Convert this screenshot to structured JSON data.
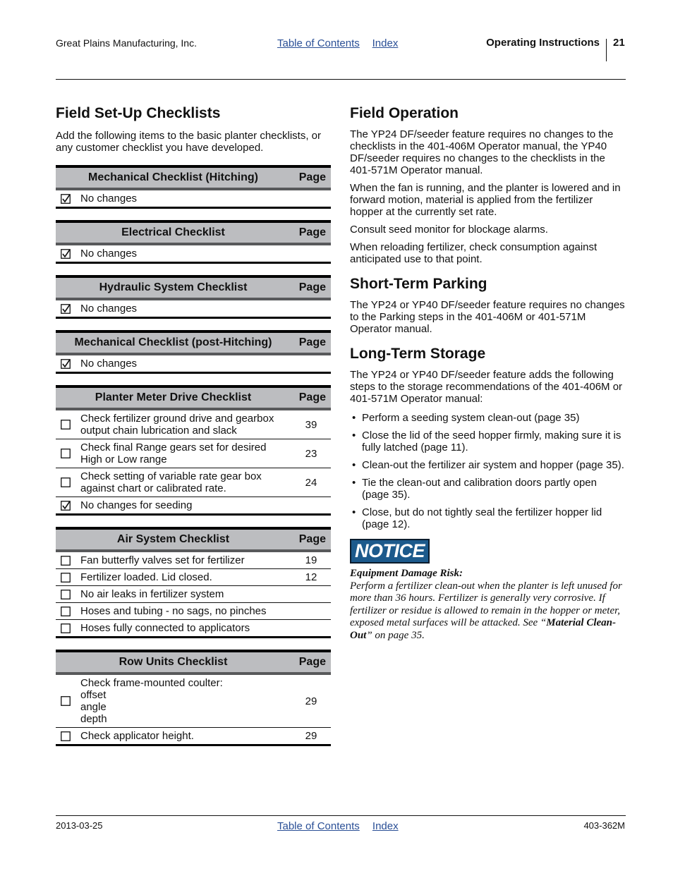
{
  "header": {
    "company": "Great Plains Manufacturing, Inc.",
    "links": [
      "Table of Contents",
      "Index"
    ],
    "section": "Operating Instructions",
    "page_number": "21"
  },
  "left": {
    "title": "Field Set-Up Checklists",
    "intro": "Add the following items to the basic planter checklists, or any customer checklist you have developed.",
    "page_col_label": "Page",
    "checklists": [
      {
        "title": "Mechanical Checklist (Hitching)",
        "rows": [
          {
            "checked": true,
            "lines": [
              "No changes"
            ],
            "page": ""
          }
        ]
      },
      {
        "title": "Electrical Checklist",
        "rows": [
          {
            "checked": true,
            "lines": [
              "No changes"
            ],
            "page": ""
          }
        ]
      },
      {
        "title": "Hydraulic System Checklist",
        "rows": [
          {
            "checked": true,
            "lines": [
              "No changes"
            ],
            "page": ""
          }
        ]
      },
      {
        "title": "Mechanical Checklist (post-Hitching)",
        "rows": [
          {
            "checked": true,
            "lines": [
              "No changes"
            ],
            "page": ""
          }
        ]
      },
      {
        "title": "Planter Meter Drive Checklist",
        "rows": [
          {
            "checked": false,
            "lines": [
              "Check fertilizer ground drive and gearbox",
              "output chain lubrication and slack"
            ],
            "page": "39"
          },
          {
            "checked": false,
            "lines": [
              "Check final Range gears set for desired",
              "High or Low range"
            ],
            "page": "23"
          },
          {
            "checked": false,
            "lines": [
              "Check setting of variable rate gear box",
              "against chart or calibrated rate."
            ],
            "page": "24"
          },
          {
            "checked": true,
            "lines": [
              "No changes for seeding"
            ],
            "page": ""
          }
        ]
      },
      {
        "title": "Air System Checklist",
        "rows": [
          {
            "checked": false,
            "lines": [
              "Fan butterfly valves set for fertilizer"
            ],
            "page": "19"
          },
          {
            "checked": false,
            "lines": [
              "Fertilizer loaded. Lid closed."
            ],
            "page": "12"
          },
          {
            "checked": false,
            "lines": [
              "No air leaks in fertilizer system"
            ],
            "page": ""
          },
          {
            "checked": false,
            "lines": [
              "Hoses and tubing - no sags, no pinches"
            ],
            "page": ""
          },
          {
            "checked": false,
            "lines": [
              "Hoses fully connected to applicators"
            ],
            "page": ""
          }
        ]
      },
      {
        "title": "Row Units Checklist",
        "rows": [
          {
            "checked": false,
            "lines": [
              "Check frame-mounted coulter:",
              "offset",
              "angle",
              "depth"
            ],
            "page": "29"
          },
          {
            "checked": false,
            "lines": [
              "Check applicator height."
            ],
            "page": "29"
          }
        ]
      }
    ]
  },
  "right": {
    "field_operation": {
      "title": "Field Operation",
      "paragraphs": [
        "The YP24 DF/seeder feature requires no changes to the checklists in the 401-406M Operator manual, the YP40 DF/seeder requires no changes to the checklists in the 401-571M Operator manual.",
        "When the fan is running, and the planter is lowered and in forward motion, material is applied from the fertilizer hopper at the currently set rate.",
        "Consult seed monitor for blockage alarms.",
        "When reloading fertilizer, check consumption against anticipated use to that point."
      ]
    },
    "short_term": {
      "title": "Short-Term Parking",
      "paragraph": "The YP24 or YP40 DF/seeder feature requires no changes to the Parking steps in the 401-406M or 401-571M Operator manual."
    },
    "long_term": {
      "title": "Long-Term Storage",
      "paragraph": "The YP24 or YP40 DF/seeder feature adds the following steps to the storage recommendations of the 401-406M or 401-571M Operator manual:",
      "bullets": [
        "Perform a seeding system clean-out (page 35)",
        "Close the lid of the seed hopper firmly, making sure it is fully latched (page 11).",
        "Clean-out the fertilizer air system and hopper (page 35).",
        "Tie the clean-out and calibration doors partly open (page 35).",
        "Close, but do not tightly seal the fertilizer hopper lid (page 12)."
      ]
    },
    "notice": {
      "label": "NOTICE",
      "heading": "Equipment Damage Risk:",
      "text_before": "Perform a fertilizer clean-out when the planter is left unused for more than 36 hours. Fertilizer is generally very corrosive. If fertilizer or residue is allowed to remain in the hopper or meter, exposed metal surfaces will be attacked. See “",
      "link_text": "Material Clean-Out",
      "text_after": "” on page 35."
    }
  },
  "footer": {
    "date": "2013-03-25",
    "links": [
      "Table of Contents",
      "Index"
    ],
    "doc_number": "403-362M"
  },
  "colors": {
    "link": "#2a4f96",
    "table_header_bg": "#bcbdc0",
    "notice_bg": "#1c5a8c"
  }
}
